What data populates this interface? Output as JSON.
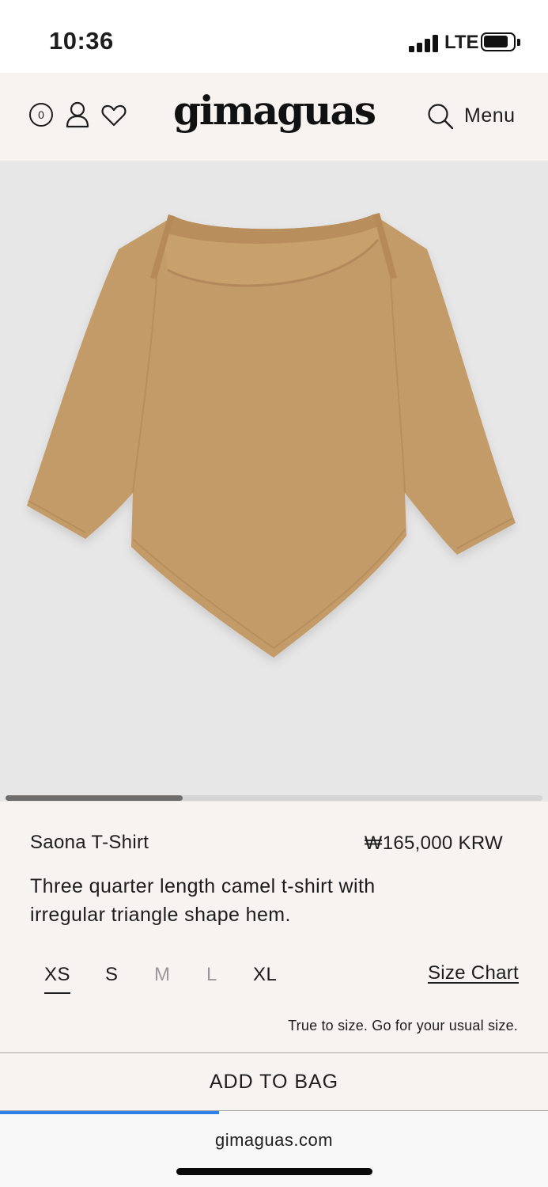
{
  "status_bar": {
    "time": "10:36",
    "network": "LTE",
    "battery_level": 0.85
  },
  "header": {
    "cart_count": "0",
    "logo": "gimaguas",
    "menu_label": "Menu",
    "icons": [
      "cart-icon",
      "account-icon",
      "wishlist-heart-icon",
      "search-icon"
    ]
  },
  "gallery": {
    "image_alt": "camel three quarter sleeve t-shirt",
    "scroll_progress": 0.33,
    "background_color": "#e8e7e8",
    "product_color": "#c39b67"
  },
  "product": {
    "name": "Saona T-Shirt",
    "price": "₩165,000 KRW",
    "description": "Three quarter length camel t-shirt with irregular triangle shape hem.",
    "sizes": [
      {
        "label": "XS",
        "state": "selected"
      },
      {
        "label": "S",
        "state": "available"
      },
      {
        "label": "M",
        "state": "unavailable"
      },
      {
        "label": "L",
        "state": "unavailable"
      },
      {
        "label": "XL",
        "state": "available"
      }
    ],
    "size_chart_label": "Size Chart",
    "fit_note": "True to size. Go for your usual size."
  },
  "cta": {
    "add_to_bag_label": "ADD TO BAG"
  },
  "browser": {
    "url": "gimaguas.com",
    "load_progress": 0.4,
    "accent_color": "#2f7fe8"
  }
}
